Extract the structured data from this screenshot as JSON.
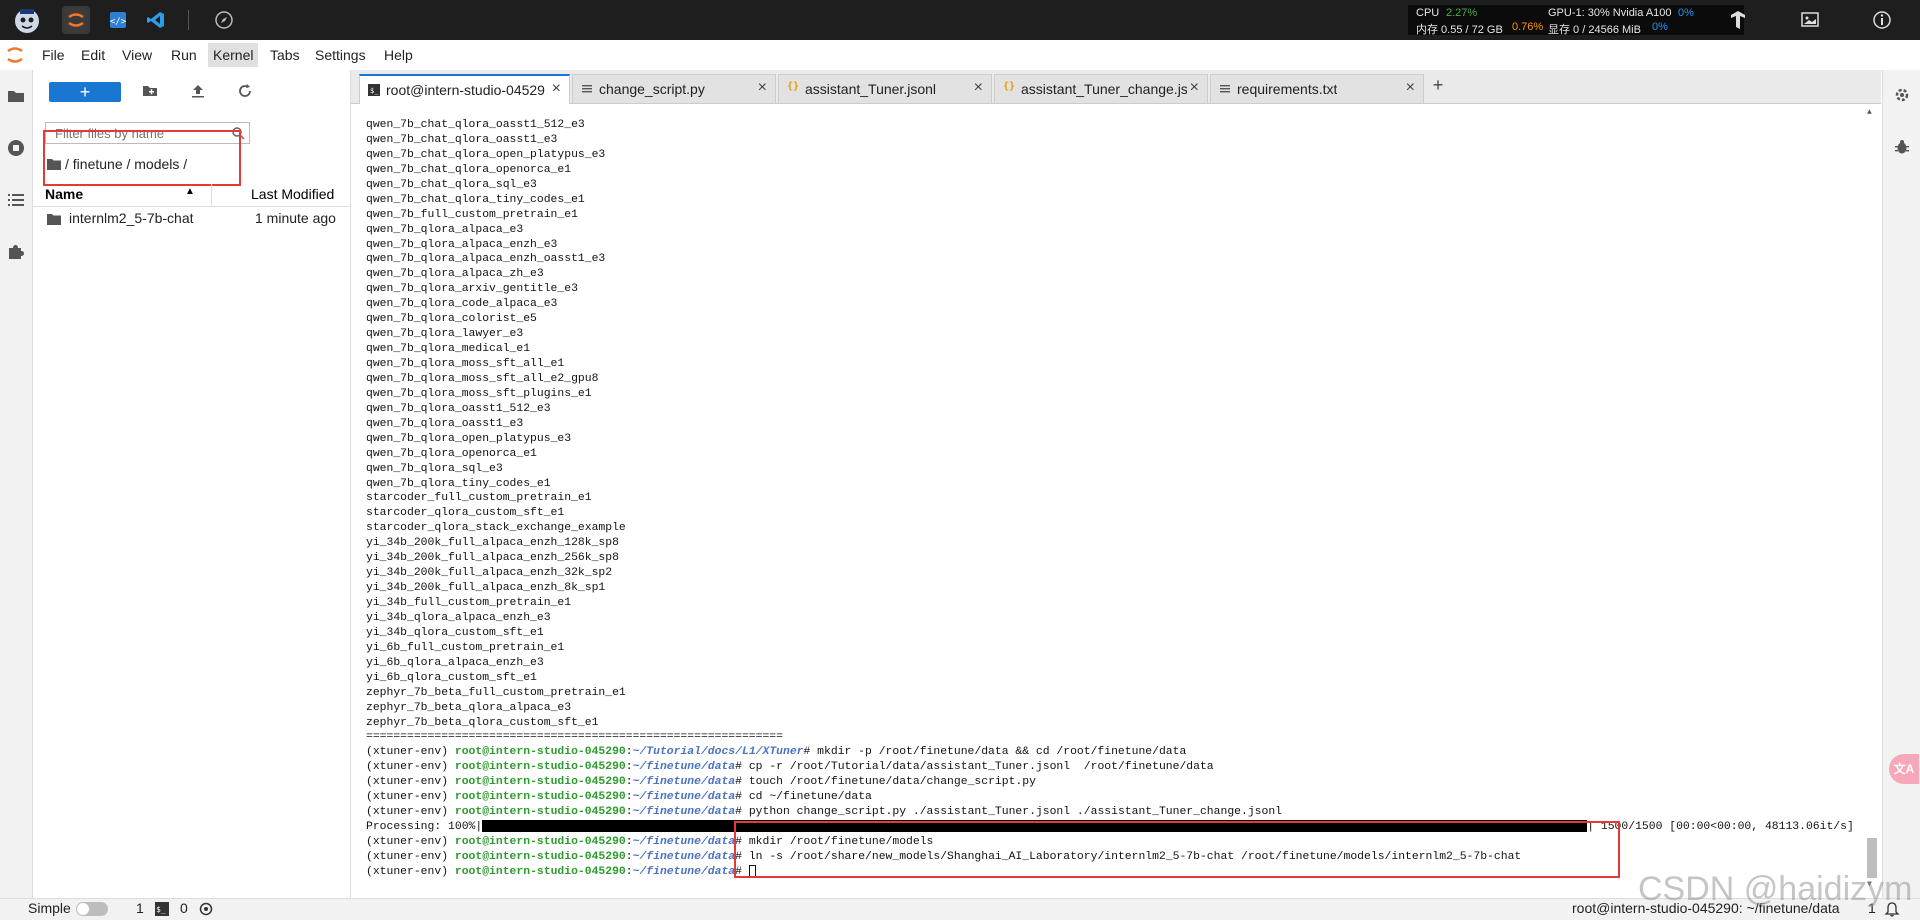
{
  "topbar": {
    "cpu_label": "CPU",
    "cpu_value": "2.27%",
    "mem_label": "内存 0.55 / 72 GB",
    "mem_value": "0.76%",
    "gpu_label": "GPU-1: 30% Nvidia A100",
    "gpu_value": "0%",
    "vram_label": "显存 0 / 24566 MiB",
    "vram_value": "0%"
  },
  "menu": [
    "File",
    "Edit",
    "View",
    "Run",
    "Kernel",
    "Tabs",
    "Settings",
    "Help"
  ],
  "filebrowser": {
    "new_label": "+",
    "filter_placeholder": "Filter files by name",
    "breadcrumb": "/ finetune / models /",
    "col_name": "Name",
    "col_modified": "Last Modified",
    "files": [
      {
        "name": "internlm2_5-7b-chat",
        "modified": "1 minute ago"
      }
    ]
  },
  "tabs": [
    {
      "label": "root@intern-studio-04529",
      "active": true,
      "icon": "terminal-icon"
    },
    {
      "label": "change_script.py",
      "active": false,
      "icon": "file-icon"
    },
    {
      "label": "assistant_Tuner.jsonl",
      "active": false,
      "icon": "json-icon"
    },
    {
      "label": "assistant_Tuner_change.jsc",
      "active": false,
      "icon": "json-icon"
    },
    {
      "label": "requirements.txt",
      "active": false,
      "icon": "file-icon"
    }
  ],
  "add_tab_label": "+",
  "terminal": {
    "listing": [
      "qwen_7b_chat_qlora_oasst1_512_e3",
      "qwen_7b_chat_qlora_oasst1_e3",
      "qwen_7b_chat_qlora_open_platypus_e3",
      "qwen_7b_chat_qlora_openorca_e1",
      "qwen_7b_chat_qlora_sql_e3",
      "qwen_7b_chat_qlora_tiny_codes_e1",
      "qwen_7b_full_custom_pretrain_e1",
      "qwen_7b_qlora_alpaca_e3",
      "qwen_7b_qlora_alpaca_enzh_e3",
      "qwen_7b_qlora_alpaca_enzh_oasst1_e3",
      "qwen_7b_qlora_alpaca_zh_e3",
      "qwen_7b_qlora_arxiv_gentitle_e3",
      "qwen_7b_qlora_code_alpaca_e3",
      "qwen_7b_qlora_colorist_e5",
      "qwen_7b_qlora_lawyer_e3",
      "qwen_7b_qlora_medical_e1",
      "qwen_7b_qlora_moss_sft_all_e1",
      "qwen_7b_qlora_moss_sft_all_e2_gpu8",
      "qwen_7b_qlora_moss_sft_plugins_e1",
      "qwen_7b_qlora_oasst1_512_e3",
      "qwen_7b_qlora_oasst1_e3",
      "qwen_7b_qlora_open_platypus_e3",
      "qwen_7b_qlora_openorca_e1",
      "qwen_7b_qlora_sql_e3",
      "qwen_7b_qlora_tiny_codes_e1",
      "starcoder_full_custom_pretrain_e1",
      "starcoder_qlora_custom_sft_e1",
      "starcoder_qlora_stack_exchange_example",
      "yi_34b_200k_full_alpaca_enzh_128k_sp8",
      "yi_34b_200k_full_alpaca_enzh_256k_sp8",
      "yi_34b_200k_full_alpaca_enzh_32k_sp2",
      "yi_34b_200k_full_alpaca_enzh_8k_sp1",
      "yi_34b_full_custom_pretrain_e1",
      "yi_34b_qlora_alpaca_enzh_e3",
      "yi_34b_qlora_custom_sft_e1",
      "yi_6b_full_custom_pretrain_e1",
      "yi_6b_qlora_alpaca_enzh_e3",
      "yi_6b_qlora_custom_sft_e1",
      "zephyr_7b_beta_full_custom_pretrain_e1",
      "zephyr_7b_beta_qlora_alpaca_e3",
      "zephyr_7b_beta_qlora_custom_sft_e1"
    ],
    "separator": "=============================================================",
    "env": "(xtuner-env) ",
    "userhost": "root@intern-studio-045290",
    "colon": ":",
    "hash": "# ",
    "commands": [
      {
        "path": "~/Tutorial/docs/L1/XTuner",
        "cmd": "mkdir -p /root/finetune/data && cd /root/finetune/data"
      },
      {
        "path": "~/finetune/data",
        "cmd": "cp -r /root/Tutorial/data/assistant_Tuner.jsonl  /root/finetune/data"
      },
      {
        "path": "~/finetune/data",
        "cmd": "touch /root/finetune/data/change_script.py"
      },
      {
        "path": "~/finetune/data",
        "cmd": "cd ~/finetune/data"
      },
      {
        "path": "~/finetune/data",
        "cmd": "python change_script.py ./assistant_Tuner.jsonl ./assistant_Tuner_change.jsonl"
      }
    ],
    "progress_label": "Processing: 100%|",
    "progress_fraction": 1.0,
    "progress_tail": "| 1500/1500 [00:00<00:00, 48113.06it/s]",
    "commands_after": [
      {
        "path": "~/finetune/data",
        "cmd": "mkdir /root/finetune/models"
      },
      {
        "path": "~/finetune/data",
        "cmd": "ln -s /root/share/new_models/Shanghai_AI_Laboratory/internlm2_5-7b-chat /root/finetune/models/internlm2_5-7b-chat"
      },
      {
        "path": "~/finetune/data",
        "cmd": ""
      }
    ]
  },
  "statusbar": {
    "mode_label": "Simple",
    "terminals_count": "1",
    "kernels_count": "0",
    "right_text": "root@intern-studio-045290: ~/finetune/data",
    "right_num": "1"
  },
  "watermark": "CSDN @haidizym",
  "colors": {
    "accent": "#1976d2",
    "highlight": "#e53935",
    "prompt_user": "#2e9b2e",
    "prompt_path": "#4b73c3"
  }
}
